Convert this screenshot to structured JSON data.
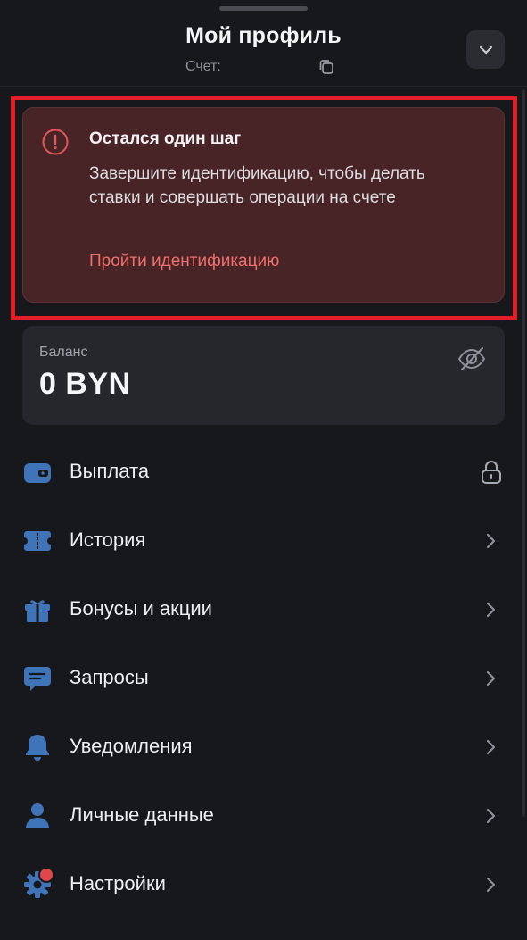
{
  "header": {
    "title": "Мой профиль",
    "account_label": "Счет:",
    "copy_icon": "copy-icon",
    "collapse_icon": "chevron-down-icon"
  },
  "alert": {
    "icon": "exclamation-circle-icon",
    "title": "Остался один шаг",
    "text": "Завершите идентификацию, чтобы делать ставки и совершать операции на счете",
    "link": "Пройти идентификацию",
    "colors": {
      "background": "#492426",
      "link": "#ee6f6d",
      "highlight": "#e41e26"
    }
  },
  "balance": {
    "label": "Баланс",
    "value": "0 BYN",
    "visibility_icon": "eye-off-icon"
  },
  "menu": {
    "items": [
      {
        "label": "Выплата",
        "icon": "wallet-icon",
        "trail": "lock-icon"
      },
      {
        "label": "История",
        "icon": "ticket-icon",
        "trail": "chevron-right-icon"
      },
      {
        "label": "Бонусы и акции",
        "icon": "gift-icon",
        "trail": "chevron-right-icon"
      },
      {
        "label": "Запросы",
        "icon": "chat-icon",
        "trail": "chevron-right-icon"
      },
      {
        "label": "Уведомления",
        "icon": "bell-icon",
        "trail": "chevron-right-icon"
      },
      {
        "label": "Личные данные",
        "icon": "user-icon",
        "trail": "chevron-right-icon"
      },
      {
        "label": "Настройки",
        "icon": "gear-icon",
        "trail": "chevron-right-icon",
        "badge": "notification-dot"
      }
    ]
  },
  "colors": {
    "accent_icon": "#3f74b8",
    "background": "#17181c",
    "card": "#25272c"
  }
}
